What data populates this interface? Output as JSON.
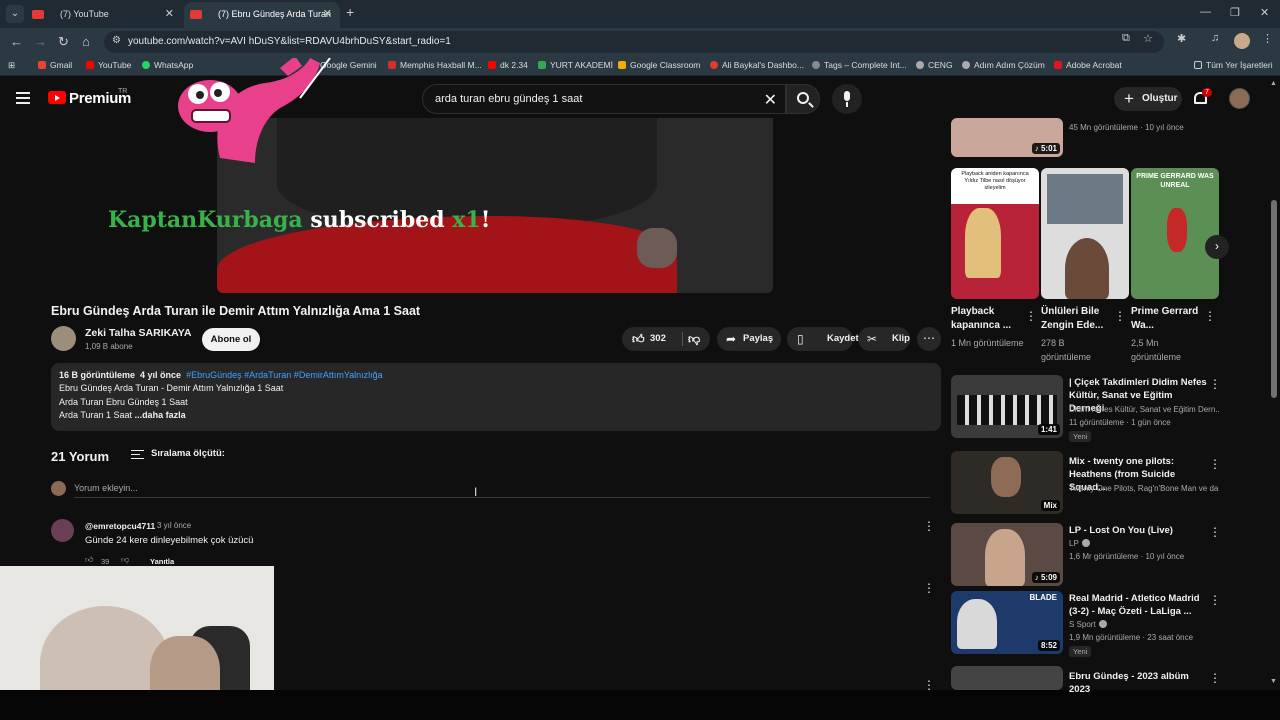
{
  "browser": {
    "tabs": [
      {
        "title": "(7) YouTube"
      },
      {
        "title": "(7) Ebru Gündeş Arda Turan ile"
      }
    ],
    "url": "youtube.com/watch?v=AVI  hDuSY&list=RDAVU4brhDuSY&start_radio=1",
    "bookmarks": [
      "Gmail",
      "YouTube",
      "WhatsApp",
      "Dünya Konuş: Ank",
      "Google Gemini",
      "Memphis Haxball M...",
      "dk 2.34",
      "YURT AKADEMİ",
      "Google Classroom",
      "Ali Baykal's Dashbo...",
      "Tags – Complete Int...",
      "CENG",
      "Adım Adım Çözüm",
      "Adobe Acrobat",
      "Tüm Yer İşaretleri"
    ]
  },
  "masthead": {
    "logo": "Premium",
    "region": "TR",
    "search_query": "arda turan ebru gündeş 1 saat",
    "create_label": "Oluştur",
    "notification_count": "7"
  },
  "video": {
    "overlay_name": "KaptanKurbaga",
    "overlay_text": "subscribed",
    "overlay_count": "x1",
    "overlay_bang": "!",
    "title": "Ebru Gündeş Arda Turan ile Demir Attım Yalnızlığa Ama 1 Saat",
    "channel": "Zeki Talha SARIKAYA",
    "subscribers": "1,09 B abone",
    "subscribe_label": "Abone ol",
    "likes": "302",
    "share_label": "Paylaş",
    "save_label": "Kaydet",
    "clip_label": "Klip"
  },
  "description": {
    "views": "16 B görüntüleme",
    "age": "4 yıl önce",
    "tags": "#EbruGündeş #ArdaTuran #DemirAttımYalnızlığa",
    "line1": "Ebru Gündeş Arda Turan - Demir Attım Yalnızlığa 1 Saat",
    "line2": "Arda Turan Ebru Gündeş 1 Saat",
    "line3": "Arda Turan 1 Saat",
    "more": "...daha fazla"
  },
  "comments": {
    "count_label": "21 Yorum",
    "sort_label": "Sıralama ölçütü:",
    "add_placeholder": "Yorum ekleyin...",
    "items": [
      {
        "user": "@emretopcu4711",
        "time": "3 yıl önce",
        "text": "Günde 24 kere dinleyebilmek çok üzücü",
        "likes": "39",
        "reply": "Yanıtla"
      }
    ]
  },
  "shorts": [
    {
      "title": "Playback kapanınca ...",
      "meta": "1 Mn görüntüleme",
      "thumb_caption": "Playback aniden kapanınca Yıldız Tilbe nasıl döşüyor izleyelim"
    },
    {
      "title": "Ünlüleri Bile Zengin Ede...",
      "meta": "278 B görüntüleme"
    },
    {
      "title": "Prime Gerrard Wa...",
      "meta": "2,5 Mn görüntüleme",
      "thumb_caption": "PRIME GERRARD WAS UNREAL"
    }
  ],
  "top_item": {
    "meta": "45 Mn görüntüleme · 10 yıl önce",
    "duration": "5:01"
  },
  "recommendations": [
    {
      "title": "| Çiçek Takdimleri Didim Nefes Kültür, Sanat ve Eğitim Derneği",
      "channel": "Didim Nefes Kültür, Sanat ve Eğitim Dern...",
      "meta": "11 görüntüleme · 1 gün önce",
      "badge": "Yeni",
      "duration": "1:41"
    },
    {
      "title": "Mix - twenty one pilots: Heathens (from Suicide Squad...",
      "channel": "Twenty One Pilots, Rag'n'Bone Man ve da...",
      "meta": "",
      "badge": "",
      "duration": "Mix"
    },
    {
      "title": "LP - Lost On You (Live)",
      "channel": "LP",
      "meta": "1,6 Mr görüntüleme · 10 yıl önce",
      "badge": "",
      "duration": "5:09"
    },
    {
      "title": "Real Madrid - Atletico Madrid (3-2) - Maç Özeti - LaLiga ...",
      "channel": "S Sport",
      "meta": "1,9 Mn görüntüleme · 23 saat önce",
      "badge": "Yeni",
      "duration": "8:52",
      "thumb_caption": "BLADE"
    },
    {
      "title": "Ebru Gündeş - 2023 albüm 2023",
      "channel": "",
      "meta": "",
      "badge": "",
      "duration": ""
    }
  ]
}
